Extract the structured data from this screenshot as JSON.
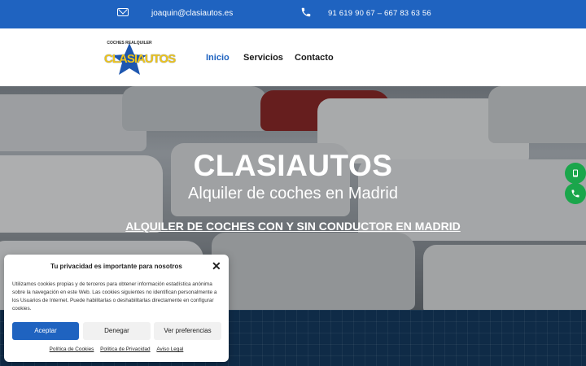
{
  "topbar": {
    "email": "joaquin@clasiautos.es",
    "phones": "91 619 90 67 – 667 83 63 56",
    "mail_icon": "envelope-icon",
    "phone_icon": "phone-icon"
  },
  "logo": {
    "top_text": "COCHES REALQUILER",
    "main_text": "CLASIAUTOS"
  },
  "nav": {
    "items": [
      {
        "label": "Inicio"
      },
      {
        "label": "Servicios"
      },
      {
        "label": "Contacto"
      }
    ]
  },
  "hero": {
    "title": "CLASIAUTOS",
    "subtitle": "Alquiler de coches en Madrid",
    "link": "ALQUILER DE COCHES CON Y SIN CONDUCTOR EN MADRID"
  },
  "floating": {
    "whatsapp_icon": "whatsapp-icon",
    "phone_icon": "phone-icon"
  },
  "cookie": {
    "title": "Tu privacidad es importante para nosotros",
    "body": "Utilizamos cookies propias y de terceros para obtener información estadística anónima sobre la navegación en este Web. Las cookies siguientes no identifican personalmente a los Usuarios de Internet. Puede habilitarlas o deshabilitarlas directamente en configurar cookies.",
    "accept": "Aceptar",
    "deny": "Denegar",
    "prefs": "Ver preferencias",
    "links": [
      "Política de Cookies",
      "Política de Privacidad",
      "Aviso Legal"
    ]
  },
  "colors": {
    "topbar": "#1f63c0",
    "accent": "#1f63c0",
    "whatsapp": "#1aa64b",
    "bottom": "#0f2b47"
  }
}
